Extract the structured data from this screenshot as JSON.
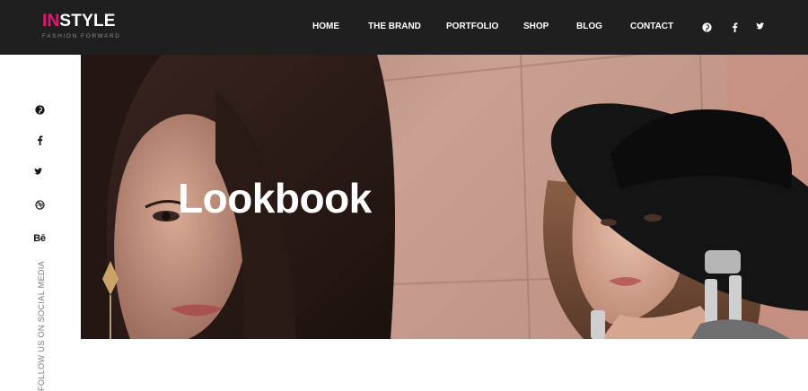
{
  "header": {
    "logo": {
      "accent": "IN",
      "rest": "STYLE",
      "tagline": "FASHION FORWARD"
    },
    "nav": [
      {
        "label": "HOME"
      },
      {
        "label": "THE BRAND"
      },
      {
        "label": "PORTFOLIO"
      },
      {
        "label": "SHOP"
      },
      {
        "label": "BLOG"
      },
      {
        "label": "CONTACT"
      }
    ],
    "social_icons": [
      "pinterest-icon",
      "facebook-icon",
      "twitter-icon"
    ]
  },
  "sidebar": {
    "social_icons": [
      "pinterest-icon",
      "facebook-icon",
      "twitter-icon",
      "dribbble-icon",
      "behance-icon"
    ],
    "behance_label": "Bē",
    "follow_text": "FOLLOW US ON SOCIAL MEDIA"
  },
  "hero": {
    "title": "Lookbook"
  },
  "colors": {
    "header_bg": "#1f1f1f",
    "accent": "#e5166f",
    "hero_wall": "#c49a8d"
  }
}
